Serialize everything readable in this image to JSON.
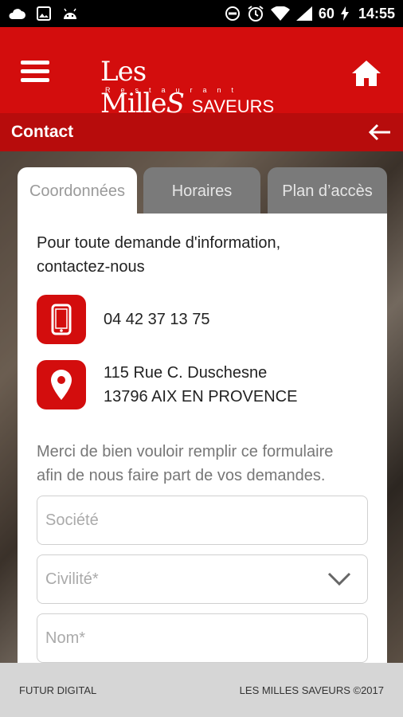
{
  "status_bar": {
    "battery": "60",
    "time": "14:55"
  },
  "app_header": {
    "logo_main": "Les Mille",
    "logo_s": "S",
    "logo_saveurs": "SAVEURS",
    "logo_sub": "Restaurant"
  },
  "page": {
    "title": "Contact"
  },
  "tabs": [
    {
      "label": "Coordonnées",
      "active": true
    },
    {
      "label": "Horaires",
      "active": false
    },
    {
      "label": "Plan d’accès",
      "active": false
    }
  ],
  "contact": {
    "intro_line1": "Pour toute demande d'information,",
    "intro_line2": "contactez-nous",
    "phone": "04 42 37 13 75",
    "address_line1": "115 Rue C. Duschesne",
    "address_line2": "13796 AIX EN PROVENCE"
  },
  "form": {
    "intro_line1": "Merci de bien vouloir remplir ce formulaire",
    "intro_line2": "afin de nous faire part de vos demandes.",
    "societe_placeholder": "Société",
    "civilite_placeholder": "Civilité*",
    "nom_placeholder": "Nom*"
  },
  "footer": {
    "left": "FUTUR DIGITAL",
    "right": "LES MILLES SAVEURS ©2017"
  },
  "colors": {
    "brand_red": "#d30d0d",
    "subbar_red": "#b70c0c"
  }
}
